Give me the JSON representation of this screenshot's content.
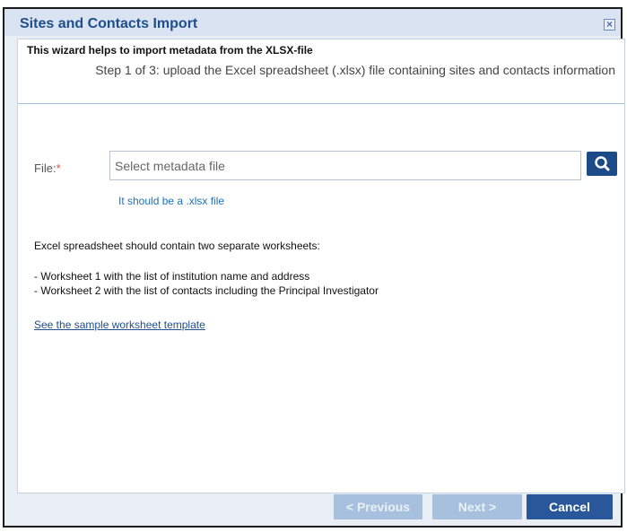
{
  "dialog": {
    "title": "Sites and Contacts Import",
    "close_icon": "close-icon",
    "intro": "This wizard helps to import metadata from the XLSX-file",
    "step": "Step 1 of 3: upload the Excel spreadsheet (.xlsx) file containing sites and contacts information"
  },
  "form": {
    "file_label": "File:",
    "required_mark": "*",
    "file_placeholder": "Select metadata file",
    "search_icon": "search-icon",
    "hint": "It should be a .xlsx file"
  },
  "info": {
    "description": "Excel spreadsheet should contain two separate worksheets:",
    "bullets": [
      "- Worksheet 1 with the list of institution name and address",
      "- Worksheet 2 with the list of contacts including the Principal Investigator"
    ],
    "sample_link": "See the sample worksheet template"
  },
  "footer": {
    "previous_label": "< Previous",
    "next_label": "Next >",
    "cancel_label": "Cancel"
  },
  "colors": {
    "title": "#1f4e8c",
    "primary_button": "#2a579a",
    "disabled_button": "#a7c0de",
    "link": "#1f6fb8",
    "required": "#e04848"
  }
}
